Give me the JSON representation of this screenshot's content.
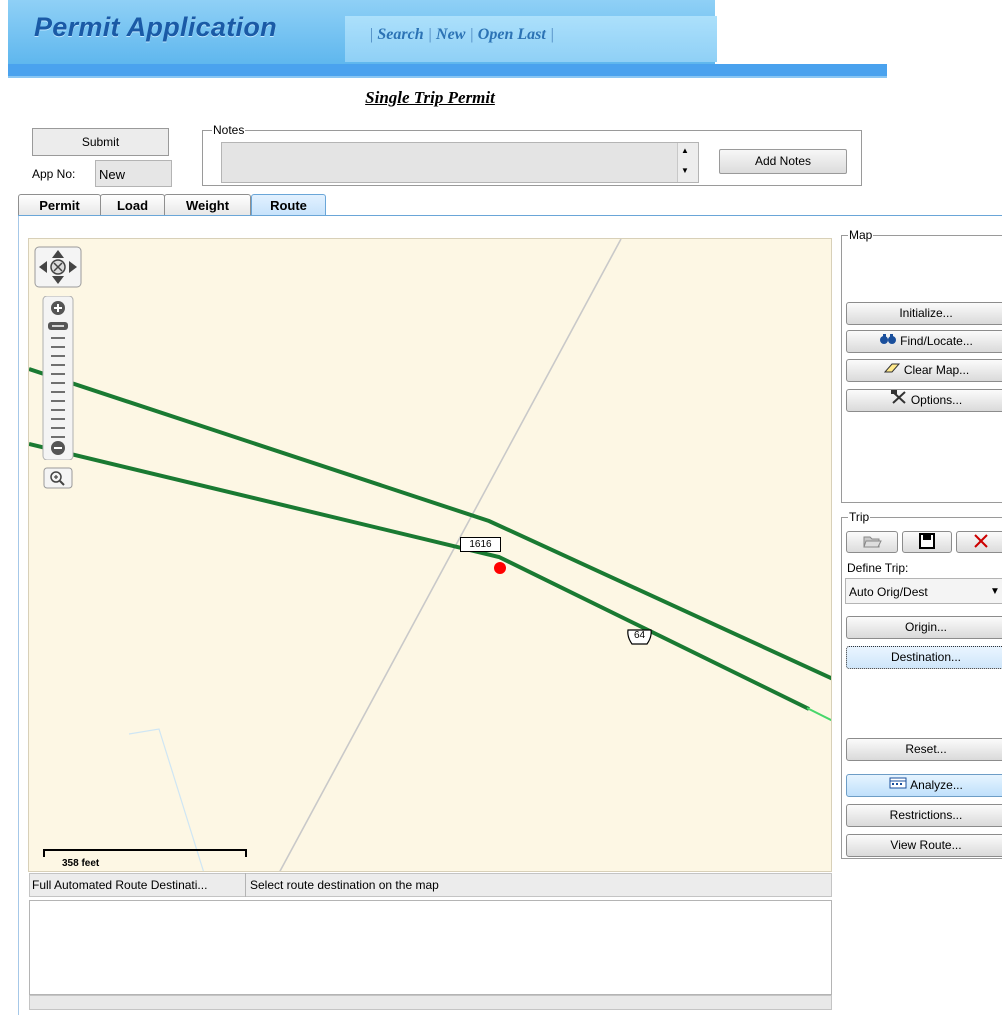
{
  "header": {
    "app_title": "Permit Application",
    "nav": {
      "search": "Search",
      "new": "New",
      "open_last": "Open Last"
    }
  },
  "page_title": "Single Trip Permit",
  "form": {
    "submit_label": "Submit",
    "app_no_label": "App No:",
    "app_no_value": "New",
    "notes_legend": "Notes",
    "notes_value": "",
    "add_notes_label": "Add Notes"
  },
  "tabs": [
    {
      "label": "Permit",
      "active": false
    },
    {
      "label": "Load",
      "active": false
    },
    {
      "label": "Weight",
      "active": false
    },
    {
      "label": "Route",
      "active": true
    }
  ],
  "map": {
    "route_sign": "1616",
    "highway_sign": "64",
    "scale_label": "358 feet",
    "colors": {
      "background": "#fdf7e4",
      "route": "#1a7a32",
      "marker": "#ff0000",
      "minor_road": "#cccccc"
    }
  },
  "status": {
    "mode": "Full Automated Route Destinati...",
    "message": "Select route destination on the map"
  },
  "map_panel": {
    "legend": "Map",
    "buttons": [
      {
        "label": "Initialize...",
        "icon": ""
      },
      {
        "label": "Find/Locate...",
        "icon": "binoculars-icon"
      },
      {
        "label": "Clear Map...",
        "icon": "eraser-icon"
      },
      {
        "label": "Options...",
        "icon": "tools-icon"
      }
    ]
  },
  "trip_panel": {
    "legend": "Trip",
    "define_label": "Define Trip:",
    "define_value": "Auto Orig/Dest",
    "buttons": [
      {
        "label": "Origin..."
      },
      {
        "label": "Destination..."
      },
      {
        "label": "Reset..."
      },
      {
        "label": "Analyze...",
        "icon": "calendar-icon"
      },
      {
        "label": "Restrictions..."
      },
      {
        "label": "View Route..."
      }
    ]
  }
}
